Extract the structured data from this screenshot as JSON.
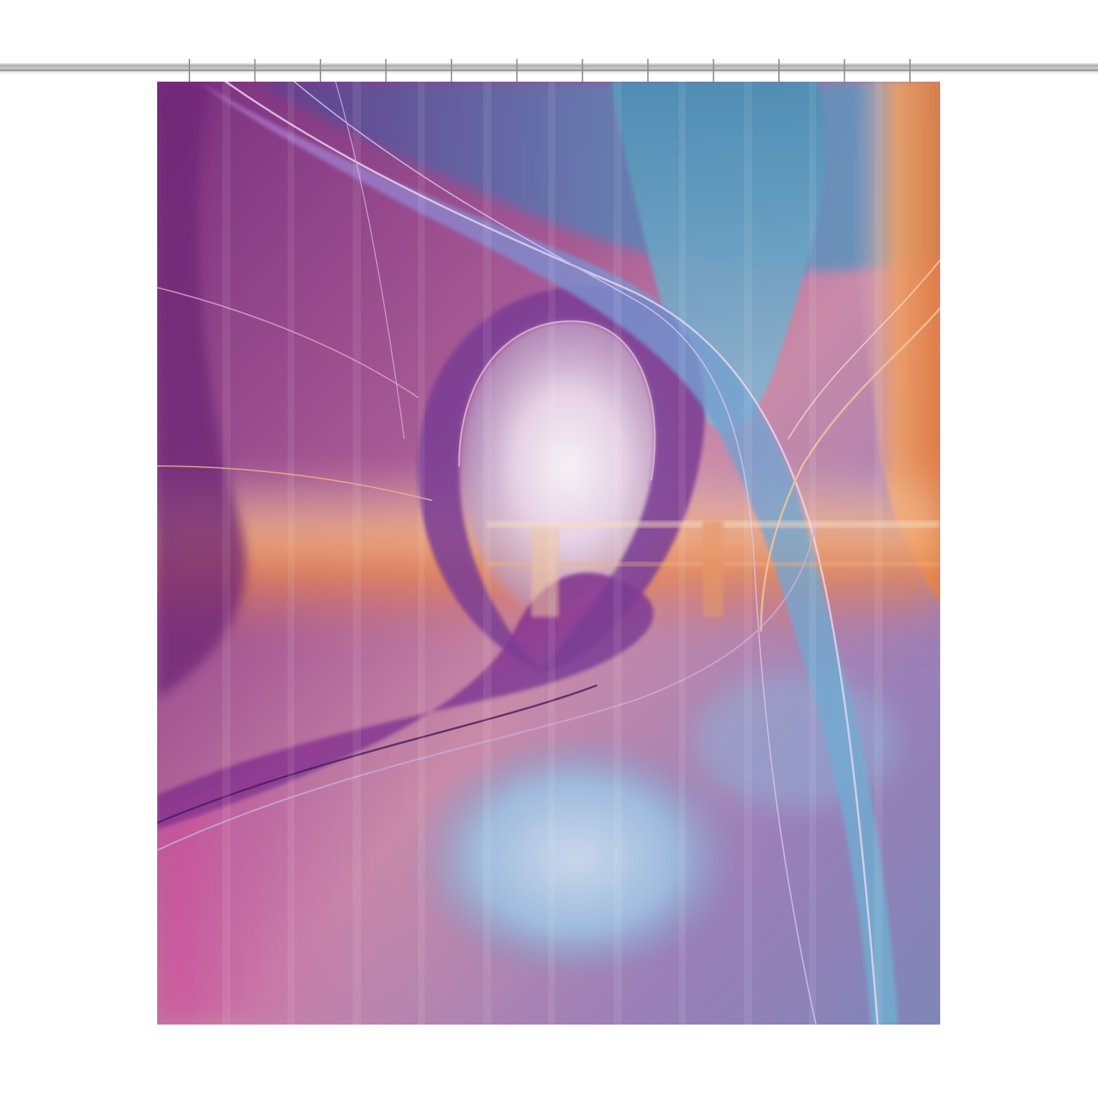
{
  "scene": {
    "subject": "shower-curtain",
    "ring_count": 12,
    "palette": {
      "purple": "#7a2d86",
      "magenta": "#c04a9c",
      "blue": "#5a86b6",
      "light_blue": "#a9c6e0",
      "orange": "#e8864a",
      "peach": "#f3c79a",
      "lavender": "#b9a6d6",
      "rod": "#a7a7a7"
    }
  }
}
